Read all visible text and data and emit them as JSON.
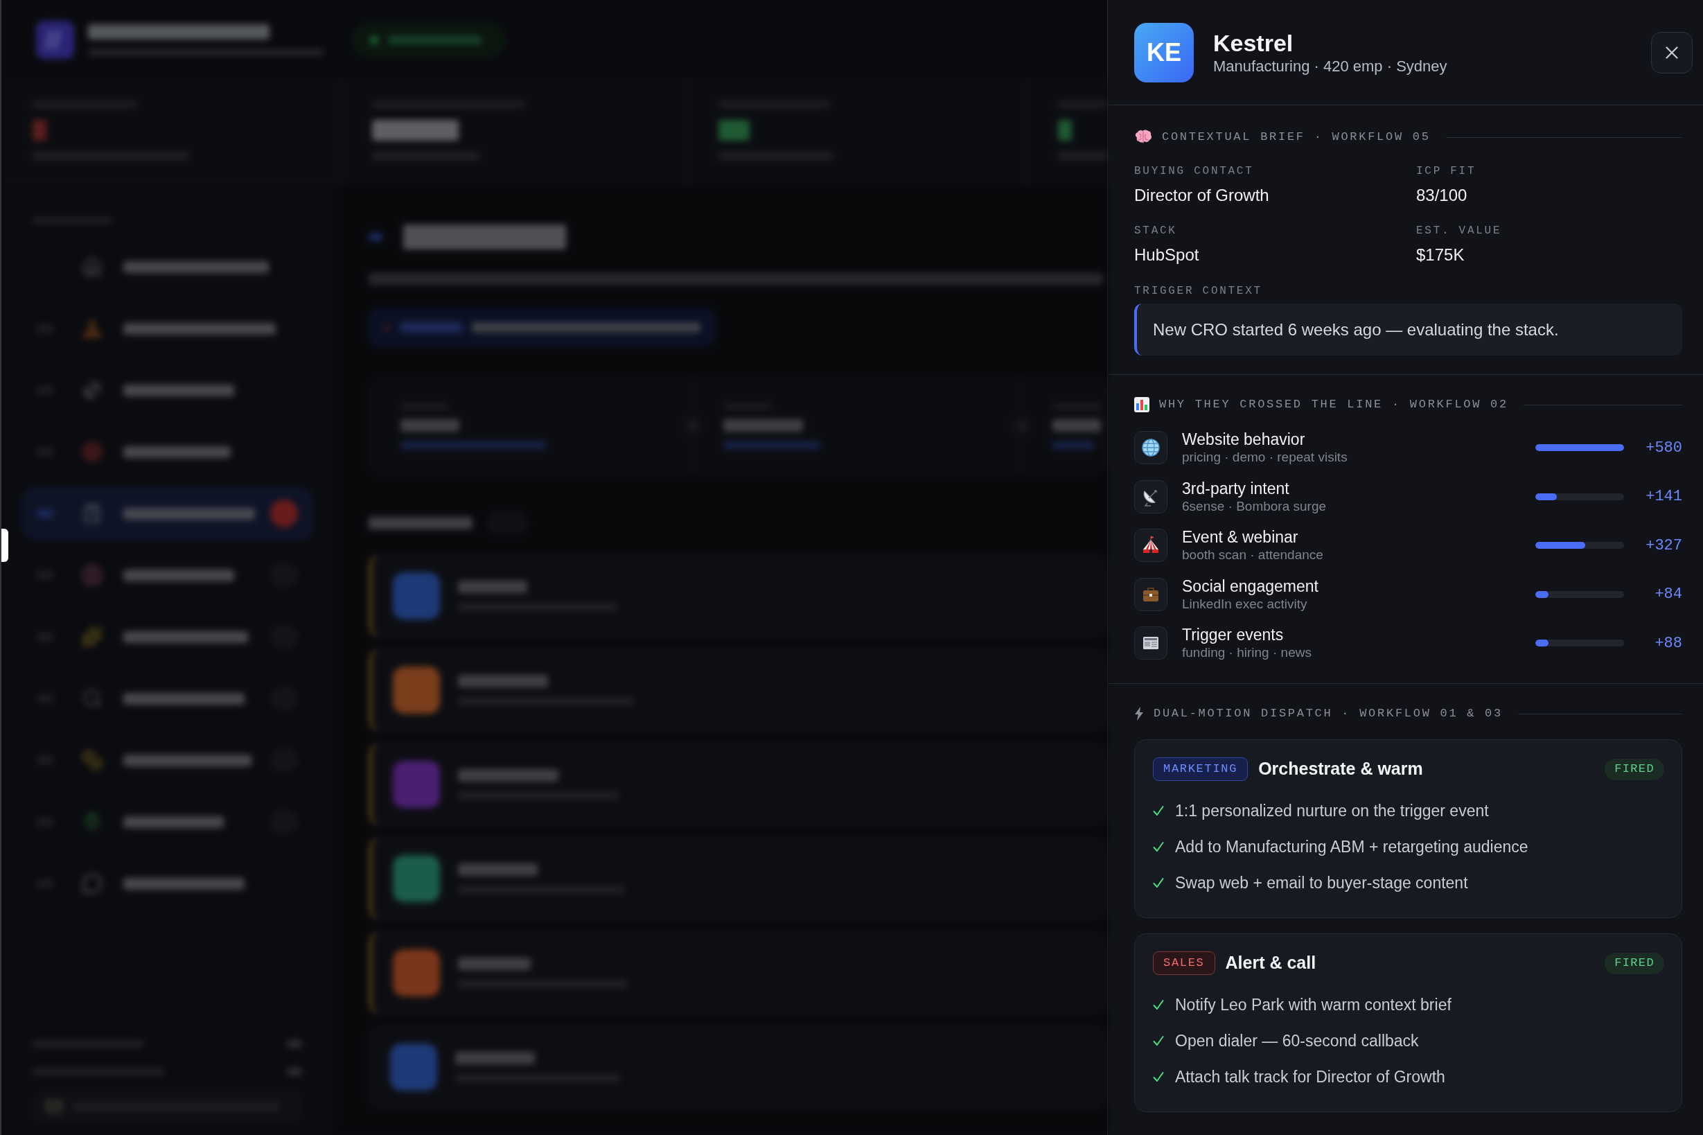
{
  "detail_panel": {
    "initials": "KE",
    "name": "Kestrel",
    "meta": "Manufacturing · 420 emp · Sydney",
    "brief": {
      "heading": "CONTEXTUAL BRIEF · WORKFLOW 05",
      "fields": [
        {
          "label": "BUYING CONTACT",
          "value": "Director of Growth"
        },
        {
          "label": "ICP FIT",
          "value": "83/100"
        },
        {
          "label": "STACK",
          "value": "HubSpot"
        },
        {
          "label": "EST. VALUE",
          "value": "$175K"
        }
      ],
      "trigger_label": "TRIGGER CONTEXT",
      "trigger": "New CRO started 6 weeks ago — evaluating the stack."
    },
    "signals": {
      "heading": "WHY THEY CROSSED THE LINE · WORKFLOW 02",
      "items": [
        {
          "title": "Website behavior",
          "detail": "pricing · demo · repeat visits",
          "level": 1,
          "score": "+580"
        },
        {
          "title": "3rd-party intent",
          "detail": "6sense · Bombora surge",
          "level": 0.24,
          "score": "+141"
        },
        {
          "title": "Event & webinar",
          "detail": "booth scan · attendance",
          "level": 0.56,
          "score": "+327"
        },
        {
          "title": "Social engagement",
          "detail": "LinkedIn exec activity",
          "level": 0.15,
          "score": "+84"
        },
        {
          "title": "Trigger events",
          "detail": "funding · hiring · news",
          "level": 0.15,
          "score": "+88"
        }
      ]
    },
    "dispatch": {
      "heading": "DUAL-MOTION DISPATCH · WORKFLOW 01 & 03",
      "motions": [
        {
          "kind": "marketing",
          "tag": "MARKETING",
          "title": "Orchestrate & warm",
          "status": "FIRED",
          "actions": [
            {
              "text": "1:1 personalized nurture on the trigger event",
              "done": true
            },
            {
              "text": "Add to Manufacturing ABM + retargeting audience",
              "done": true
            },
            {
              "text": "Swap web + email to buyer-stage content",
              "done": true
            }
          ]
        },
        {
          "kind": "sales",
          "tag": "SALES",
          "title": "Alert & call",
          "status": "FIRED",
          "actions": [
            {
              "text": "Notify Leo Park with warm context brief",
              "done": true
            },
            {
              "text": "Open dialer — 60-second callback",
              "done": true
            },
            {
              "text": "Attach talk track for Director of Growth",
              "done": true
            }
          ]
        }
      ]
    }
  }
}
